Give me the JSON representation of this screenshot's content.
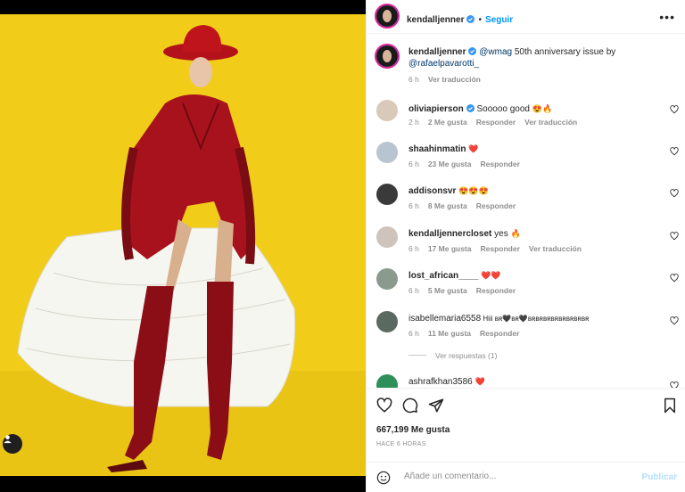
{
  "post": {
    "author": "kendalljenner",
    "follow_label": "Seguir",
    "dot": "•",
    "more": "•••"
  },
  "caption": {
    "username": "kendalljenner",
    "mention1": "@wmag",
    "text": " 50th anniversary issue by",
    "mention2": "@rafaelpavarotti_",
    "time": "6 h",
    "translate": "Ver traducción"
  },
  "comments": [
    {
      "username": "oliviapierson",
      "verified": true,
      "text": " Sooooo good ",
      "emoji": [
        "😍",
        "🔥"
      ],
      "time": "2 h",
      "likes": "2 Me gusta",
      "reply": "Responder",
      "translate": "Ver traducción"
    },
    {
      "username": "shaahinmatin",
      "verified": false,
      "text": " ",
      "emoji": [
        "❤️"
      ],
      "time": "6 h",
      "likes": "23 Me gusta",
      "reply": "Responder",
      "translate": ""
    },
    {
      "username": "addisonsvr",
      "verified": false,
      "text": " ",
      "emoji": [
        "😍",
        "😍",
        "😍"
      ],
      "time": "6 h",
      "likes": "8 Me gusta",
      "reply": "Responder",
      "translate": ""
    },
    {
      "username": "kendalljennercloset",
      "verified": false,
      "text": " yes ",
      "emoji": [
        "🔥"
      ],
      "time": "6 h",
      "likes": "17 Me gusta",
      "reply": "Responder",
      "translate": "Ver traducción"
    },
    {
      "username": "lost_african____",
      "verified": false,
      "text": " ",
      "emoji": [
        "❤️",
        "❤️"
      ],
      "time": "6 h",
      "likes": "5 Me gusta",
      "reply": "Responder",
      "translate": ""
    },
    {
      "username": "isabellemaria6558",
      "verified": false,
      "text": " Hiii ʙʀ🖤ʙʀ🖤ʙʀʙʀʙʀʙʀʙʀʙʀʙʀʙʀ",
      "emoji": [],
      "time": "6 h",
      "likes": "11 Me gusta",
      "reply": "Responder",
      "translate": ""
    },
    {
      "username": "ashrafkhan3586",
      "verified": false,
      "text": " ",
      "emoji": [
        "❤️"
      ],
      "time": "",
      "likes": "",
      "reply": "",
      "translate": ""
    }
  ],
  "view_replies": "Ver respuestas (1)",
  "likes_total": "667,199 Me gusta",
  "posted_ago": "HACE 6 HORAS",
  "comment_box": {
    "placeholder": "Añade un comentario...",
    "publish": "Publicar"
  },
  "colors": {
    "background_yellow": "#f1cd1a",
    "accent_blue": "#0095f6",
    "publish_disabled": "#b2dffc",
    "heart_red": "#ed4956"
  }
}
